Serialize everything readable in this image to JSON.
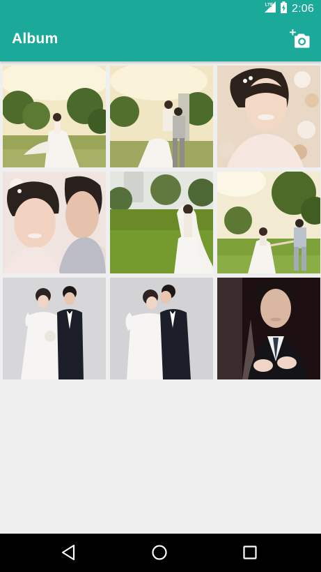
{
  "status_bar": {
    "network_label": "LTE",
    "time": "2:06",
    "background": "#1ba99a"
  },
  "app_bar": {
    "title": "Album",
    "action_icon": "add-a-photo-icon",
    "background": "#1ba99a"
  },
  "album": {
    "photos": [
      {
        "name": "bride-in-sunlit-field",
        "scene": "outdoor"
      },
      {
        "name": "groom-lifting-bride",
        "scene": "outdoor"
      },
      {
        "name": "bride-closeup-with-flowers",
        "scene": "portrait"
      },
      {
        "name": "groom-kissing-bride-cheek",
        "scene": "portrait"
      },
      {
        "name": "bride-on-lawn-with-veil",
        "scene": "outdoor"
      },
      {
        "name": "couple-walking-hand-in-hand",
        "scene": "outdoor"
      },
      {
        "name": "couple-studio-portrait",
        "scene": "studio"
      },
      {
        "name": "groom-kissing-bride-studio",
        "scene": "studio"
      },
      {
        "name": "bride-adjusting-groom-tie",
        "scene": "studio-dark"
      }
    ]
  },
  "navigation_bar": {
    "buttons": [
      "back-icon",
      "home-icon",
      "recents-icon"
    ]
  }
}
